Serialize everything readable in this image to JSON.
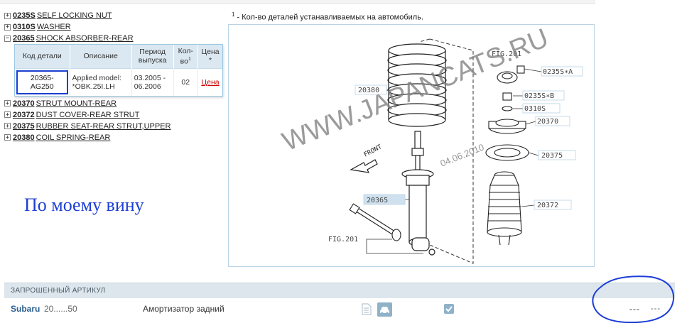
{
  "parts_tree": {
    "items": [
      {
        "toggle": "+",
        "code": "0235S",
        "name": "SELF LOCKING NUT"
      },
      {
        "toggle": "+",
        "code": "0310S",
        "name": "WASHER"
      },
      {
        "toggle": "−",
        "code": "20365",
        "name": "SHOCK ABSORBER-REAR"
      },
      {
        "toggle": "+",
        "code": "20370",
        "name": "STRUT MOUNT-REAR"
      },
      {
        "toggle": "+",
        "code": "20372",
        "name": "DUST COVER-REAR STRUT"
      },
      {
        "toggle": "+",
        "code": "20375",
        "name": "RUBBER SEAT-REAR STRUT,UPPER"
      },
      {
        "toggle": "+",
        "code": "20380",
        "name": "COIL SPRING-REAR"
      }
    ]
  },
  "detail_table": {
    "headers": {
      "code": "Код детали",
      "desc": "Описание",
      "period": "Период выпуска",
      "qty": "Кол-во",
      "qty_sup": "1",
      "price": "Цена *"
    },
    "row": {
      "code": "20365-AG250",
      "desc": "Applied model: *OBK.25I.LH",
      "period": "03.2005 - 06.2006",
      "qty": "02",
      "price": "Цена"
    }
  },
  "footnote": {
    "sup": "1",
    "text": " - Кол-во деталей устанавливаемых на автомобиль."
  },
  "handwritten_note": "По моему вину",
  "diagram": {
    "watermark": "WWW.JAPANCATS.RU",
    "date_stamp": "04.06.2010",
    "labels": {
      "fig_top": "FIG.201",
      "fig_bottom": "FIG.201",
      "nut_a": "0235S∗A",
      "nut_b": "0235S∗B",
      "washer": "0310S",
      "mount": "20370",
      "seat": "20375",
      "dust": "20372",
      "spring": "20380",
      "shock": "20365",
      "front": "FRONT"
    }
  },
  "results": {
    "header_title": "ЗАПРОШЕННЫЙ АРТИКУЛ",
    "row": {
      "brand": "Subaru",
      "article": "20......50",
      "description": "Амортизатор задний",
      "value1": "---",
      "value2": "---"
    }
  },
  "colors": {
    "accent_blue": "#1d3ed6",
    "table_header_bg": "#dbe8f1",
    "price_red": "#cc0000",
    "results_header_bg": "#dde6ec",
    "icon_button": "#8fb2c9"
  }
}
